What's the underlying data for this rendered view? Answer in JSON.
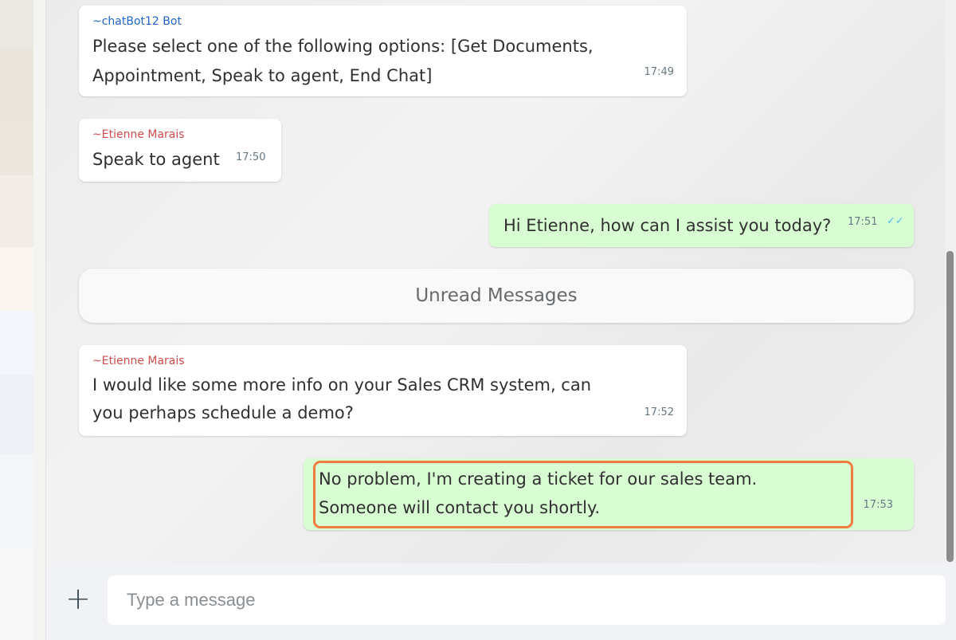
{
  "messages": [
    {
      "sender": "~chatBot12 Bot",
      "lines": [
        "Please select one of the following options: [Get Documents,",
        "Appointment, Speak to agent, End Chat]"
      ],
      "time": "17:49",
      "direction": "incoming"
    },
    {
      "sender": "~Etienne Marais",
      "lines": [
        "Speak to agent"
      ],
      "time": "17:50",
      "direction": "incoming"
    },
    {
      "lines": [
        "Hi Etienne, how can I assist you today?"
      ],
      "time": "17:51",
      "direction": "outgoing",
      "status": "read"
    },
    {
      "sender": "~Etienne Marais",
      "lines": [
        "I would like some more info on your Sales CRM system, can",
        "you perhaps schedule a demo?"
      ],
      "time": "17:52",
      "direction": "incoming"
    },
    {
      "lines": [
        "No problem, I'm creating a ticket for our sales team.",
        "Someone will contact you shortly."
      ],
      "time": "17:53",
      "direction": "outgoing",
      "highlighted": true
    }
  ],
  "unread_divider": "Unread Messages",
  "composer": {
    "placeholder": "Type a message",
    "attach_icon": "plus-icon",
    "attach_glyph": "+"
  },
  "read_tick_glyph": "✓✓",
  "colors": {
    "incoming_bubble": "#ffffff",
    "outgoing_bubble": "#d9fdd3",
    "bot_sender": "#2266c6",
    "user_sender": "#d04b4b",
    "highlight_border": "#f07c3d",
    "read_tick": "#53bdeb"
  }
}
